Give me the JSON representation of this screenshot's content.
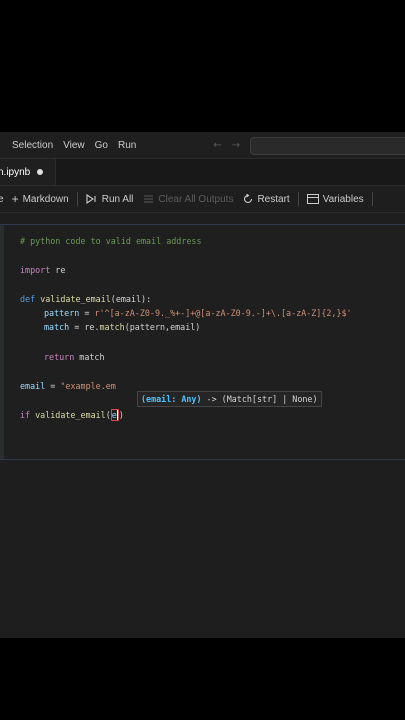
{
  "menubar": {
    "items": [
      "Selection",
      "View",
      "Go",
      "Run"
    ]
  },
  "tab": {
    "filename": "n.ipynb"
  },
  "toolbar": {
    "code_label": "e",
    "markdown_label": "Markdown",
    "run_all_label": "Run All",
    "clear_outputs_label": "Clear All Outputs",
    "restart_label": "Restart",
    "variables_label": "Variables"
  },
  "code": {
    "comment": "# python code to valid email address",
    "import_kw": "import",
    "import_mod": " re",
    "def_kw": "def",
    "def_name": "validate_email",
    "def_params": "(email):",
    "pattern_var": "pattern",
    "pattern_eq": " = ",
    "pattern_value": "r'^[a-zA-Z0-9._%+-]+@[a-zA-Z0-9.-]+\\.[a-zA-Z]{2,}$'",
    "match_var": "match",
    "match_eq": " = re.",
    "match_fn": "match",
    "match_args": "(pattern,email)",
    "return_kw": "return",
    "return_val": " match",
    "email_var": "email",
    "email_eq": " = ",
    "email_value": "\"example.em",
    "if_kw": "if",
    "if_fn": " validate_email",
    "if_paren": "(",
    "if_arg": "e",
    "if_close": ")"
  },
  "signature_hint": {
    "param": "(email: Any)",
    "rest": " -> (Match[str] | None)"
  },
  "colors": {
    "comment": "#6a9955",
    "keyword": "#c586c0",
    "def_keyword": "#569cd6",
    "function": "#dcdcaa",
    "variable": "#9cdcfe",
    "string": "#ce9178"
  }
}
